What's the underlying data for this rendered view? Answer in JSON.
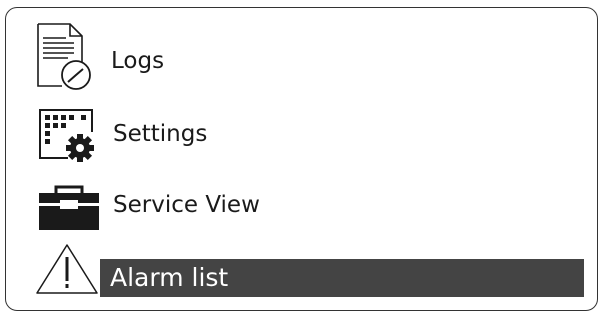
{
  "menu": {
    "items": [
      {
        "label": "Logs",
        "icon": "logs-clock-icon",
        "selected": false
      },
      {
        "label": "Settings",
        "icon": "settings-gear-icon",
        "selected": false
      },
      {
        "label": "Service View",
        "icon": "toolbox-icon",
        "selected": false
      },
      {
        "label": "Alarm list",
        "icon": "warning-icon",
        "selected": true
      }
    ]
  },
  "colors": {
    "border": "#333333",
    "text": "#1a1a1a",
    "selected_background": "#444444",
    "selected_text": "#ffffff"
  }
}
